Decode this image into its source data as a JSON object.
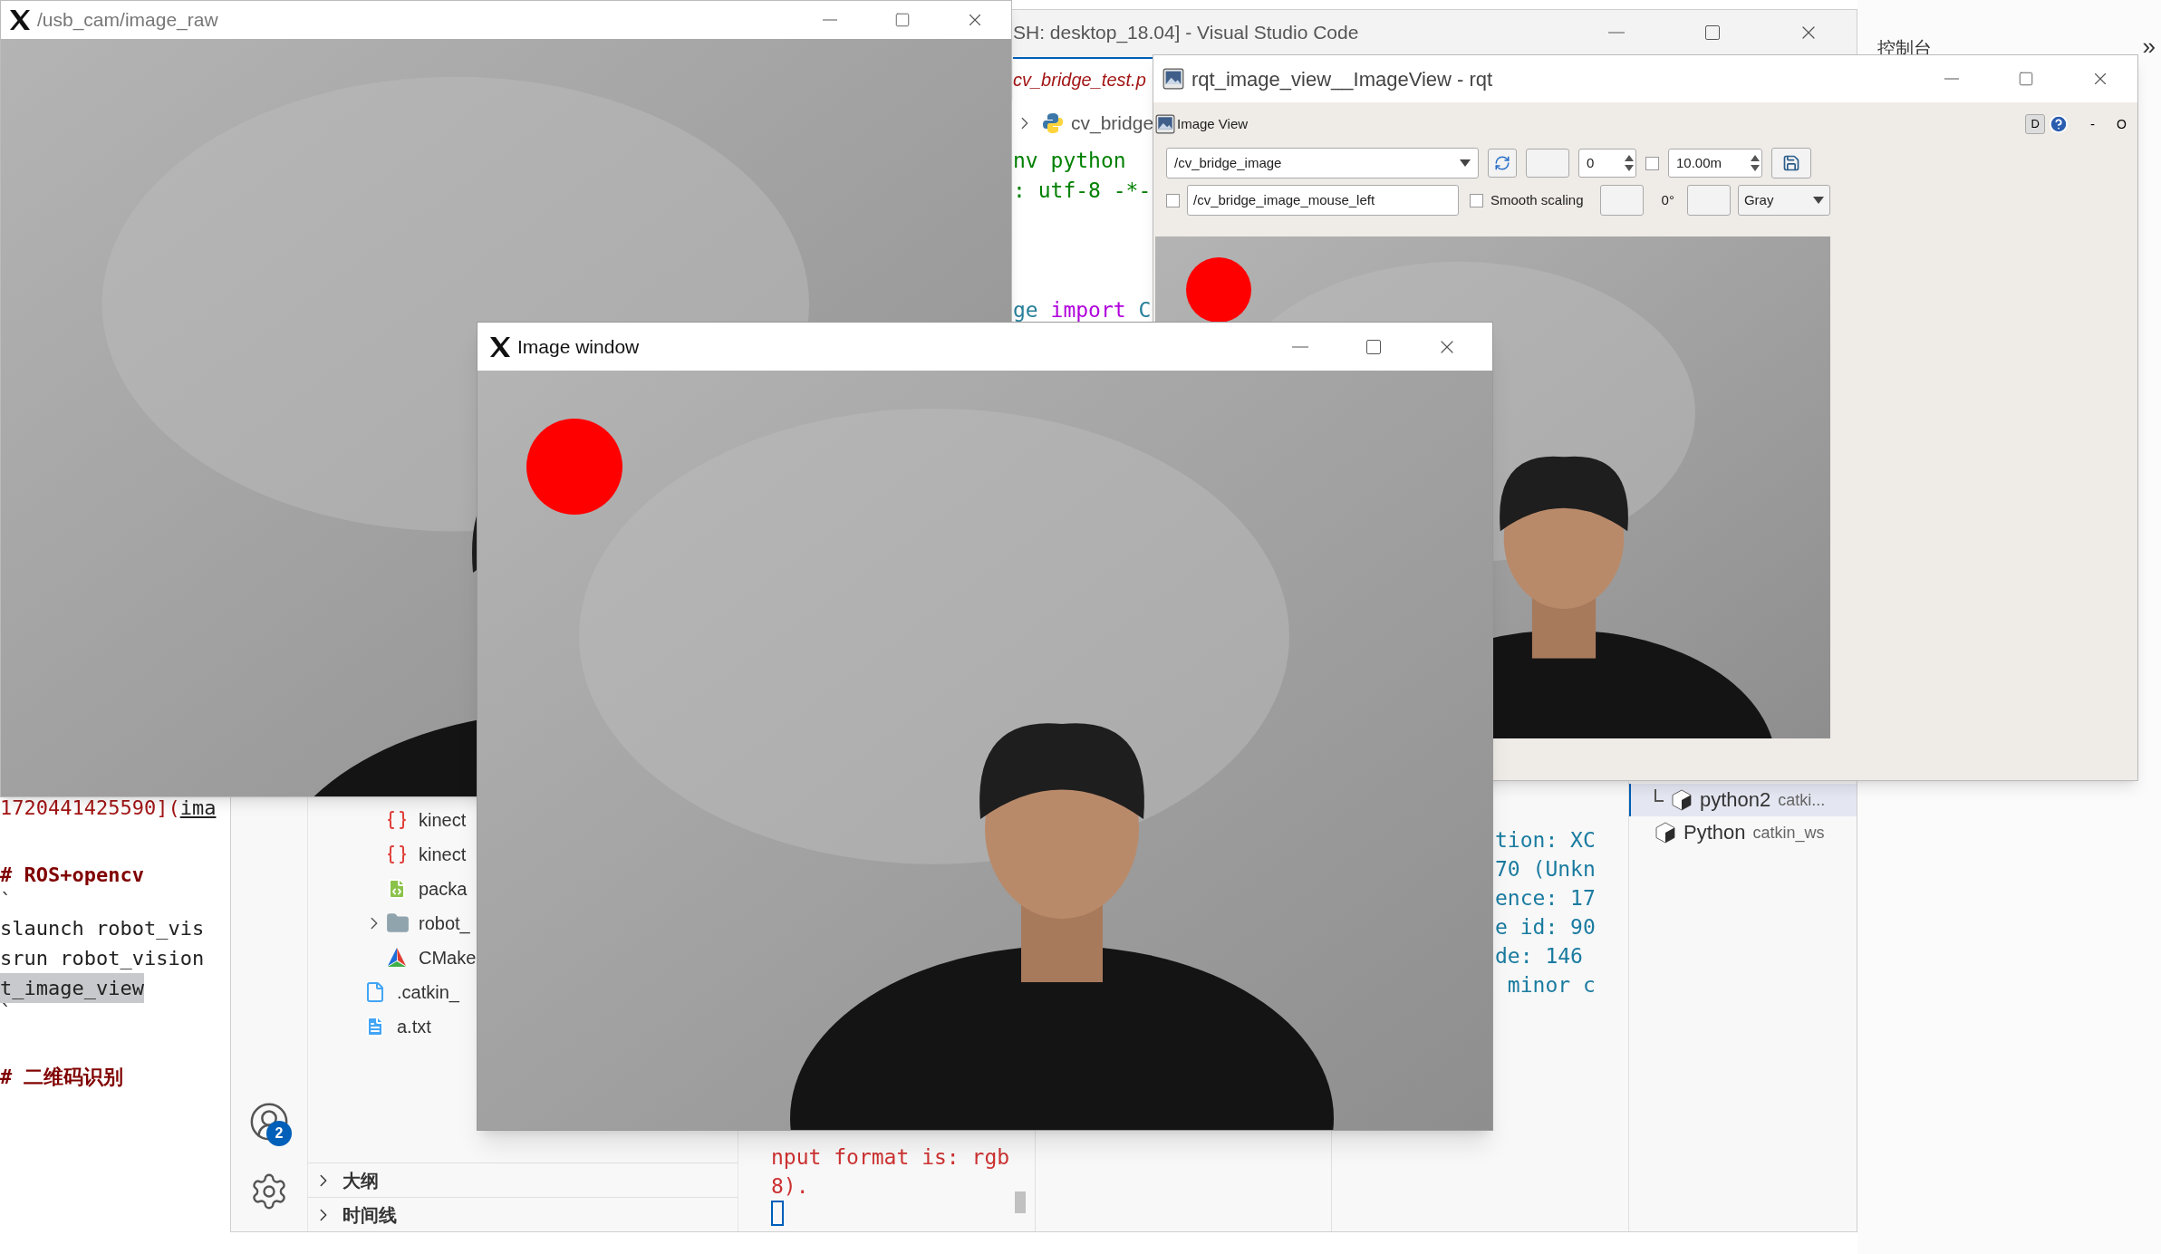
{
  "usb_cam_window": {
    "title": "/usb_cam/image_raw"
  },
  "markdown_editor": {
    "lines": [
      {
        "kind": "link",
        "text": "1720441425590](",
        "link": "ima",
        "highlighted": false
      },
      {
        "kind": "heading",
        "text": "# ROS+opencv",
        "highlighted": false
      },
      {
        "kind": "fence",
        "text": "`",
        "highlighted": false
      },
      {
        "kind": "code",
        "text": "slaunch robot_vis",
        "highlighted": false
      },
      {
        "kind": "code",
        "text": "srun robot_vision",
        "highlighted": false
      },
      {
        "kind": "code",
        "text": "t_image_view",
        "highlighted": true
      },
      {
        "kind": "fence",
        "text": "`",
        "highlighted": false
      },
      {
        "kind": "heading",
        "text": "# 二维码识别",
        "highlighted": false
      }
    ]
  },
  "vscode": {
    "title": "SH: desktop_18.04] - Visual Studio Code",
    "tab": "cv_bridge_test.p",
    "breadcrumb": "cv_bridge",
    "code_top": [
      "nv python",
      ": utf-8 -*-"
    ],
    "code_import": [
      {
        "kind": "name",
        "text": "ge "
      },
      {
        "kind": "keyword",
        "text": "import"
      },
      {
        "kind": "name",
        "text": " C"
      }
    ],
    "accounts_badge": "2",
    "explorer": {
      "tree": [
        {
          "children": [
            {
              "kind": "json",
              "label": "kinect"
            },
            {
              "kind": "json",
              "label": "kinect"
            },
            {
              "kind": "xml",
              "label": "packa"
            },
            {
              "kind": "folder",
              "label": "robot_",
              "expanded": false
            },
            {
              "kind": "cmake",
              "label": "CMake"
            }
          ]
        },
        {
          "kind": "file",
          "label": ".catkin_"
        },
        {
          "kind": "text",
          "label": "a.txt"
        }
      ],
      "sections": [
        {
          "label": "大纲",
          "expanded": false
        },
        {
          "label": "时间线",
          "expanded": false
        }
      ]
    },
    "terminal_left": {
      "lines": [
        "nput format is: rgb",
        "8)."
      ]
    },
    "terminal_right": {
      "lines": [
        "tion: XC",
        "70 (Unkn",
        "ence: 17",
        "e id: 90",
        "de: 146",
        " minor c"
      ]
    },
    "terminal_list": [
      {
        "name": "python2",
        "detail": "catki...",
        "selected": true
      },
      {
        "name": "Python",
        "detail": "catkin_ws",
        "selected": false
      }
    ]
  },
  "browser": {
    "label": "控制台",
    "overflow": "»"
  },
  "rqt_window": {
    "title": "rqt_image_view__ImageView - rqt",
    "plugin_title": "Image View",
    "d_button": "D",
    "dash": "-",
    "o_label": "O",
    "topic": "/cv_bridge_image",
    "spin_value": "0",
    "zoom_checkbox": {
      "checked": false
    },
    "zoom_value": "10.00m",
    "mouse_checkbox": {
      "checked": false
    },
    "mouse_topic": "/cv_bridge_image_mouse_left",
    "smooth_scaling": {
      "label": "Smooth scaling",
      "checked": false
    },
    "rotation": "0°",
    "color_scheme": "Gray"
  },
  "image_window": {
    "title": "Image window"
  }
}
